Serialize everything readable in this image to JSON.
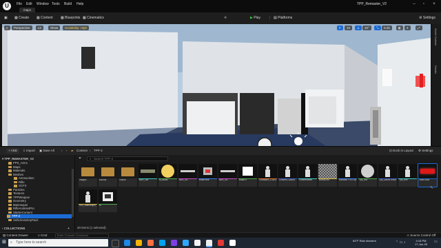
{
  "window": {
    "menus": [
      "File",
      "Edit",
      "Window",
      "Tools",
      "Build",
      "Help"
    ],
    "map_tab": "map1",
    "project_title": "TPP_Remaster_V2"
  },
  "toolbar": {
    "create": "Create",
    "content": "Content",
    "blueprints": "Blueprints",
    "cinematics": "Cinematics",
    "play": "Play",
    "platforms": "Platforms",
    "settings": "Settings"
  },
  "viewport": {
    "perspective": "Perspective",
    "lit": "Lit",
    "show": "Show",
    "scalability": "Scalability: High",
    "grid_snap": "10",
    "rot_snap": "10°",
    "scale_snap": "0.25",
    "cam_speed": "4"
  },
  "side_tabs": [
    "World Outliner",
    "Details"
  ],
  "content_browser": {
    "add": "ADD",
    "import": "Import",
    "save_all": "Save All",
    "path": [
      "Content",
      "TPP-2"
    ],
    "dock": "Dock in Layout",
    "settings": "Settings",
    "search_placeholder": "Search TPP-2",
    "project_root": "TPP_REMASTER_V2",
    "tree": [
      "FPS_Arms",
      "Maps",
      "Materials",
      "Meshes",
      "Ammunition",
      "Rifle",
      "SCFX",
      "Particles",
      "Textures",
      "TPPWeapon",
      "Geometry",
      "Mannequin",
      "RifleAnimsetPro",
      "StarterContent",
      "TPP-2",
      "VehicleVarietyPack"
    ],
    "collections": "COLLECTIONS",
    "assets_row1": [
      "Images",
      "sounds",
      "Videos",
      "BAR_SM",
      "M_Bullet",
      "BAR_SK",
      "BlastPaint",
      "BAR_SK",
      "BlastFX",
      "Character_C1103",
      "Children_Sound",
      "ChildrenAnim",
      "BrandGrid",
      "Random 7761 Sp",
      "Tps_Rot",
      "Tps_Dance Move",
      "Tps_Rev",
      "Team Bots"
    ],
    "assets_row2": [
      "UE4_Mannequin_Skeleton",
      "M"
    ],
    "item_count": "20 items (1 selected)"
  },
  "bottom_bar": {
    "content_drawer": "Content Drawer",
    "cmd": "Cmd",
    "console_placeholder": "Enter Console Command",
    "source_control": "Source Control Off"
  },
  "taskbar": {
    "search_placeholder": "Type here to search",
    "weather": "64°F  Rain showers",
    "time": "4:15 PM",
    "date": "17-Jun-25"
  },
  "colors": {
    "play": "#3ec63e",
    "accent_blue": "#1c6bd3",
    "folder": "#caa050"
  }
}
